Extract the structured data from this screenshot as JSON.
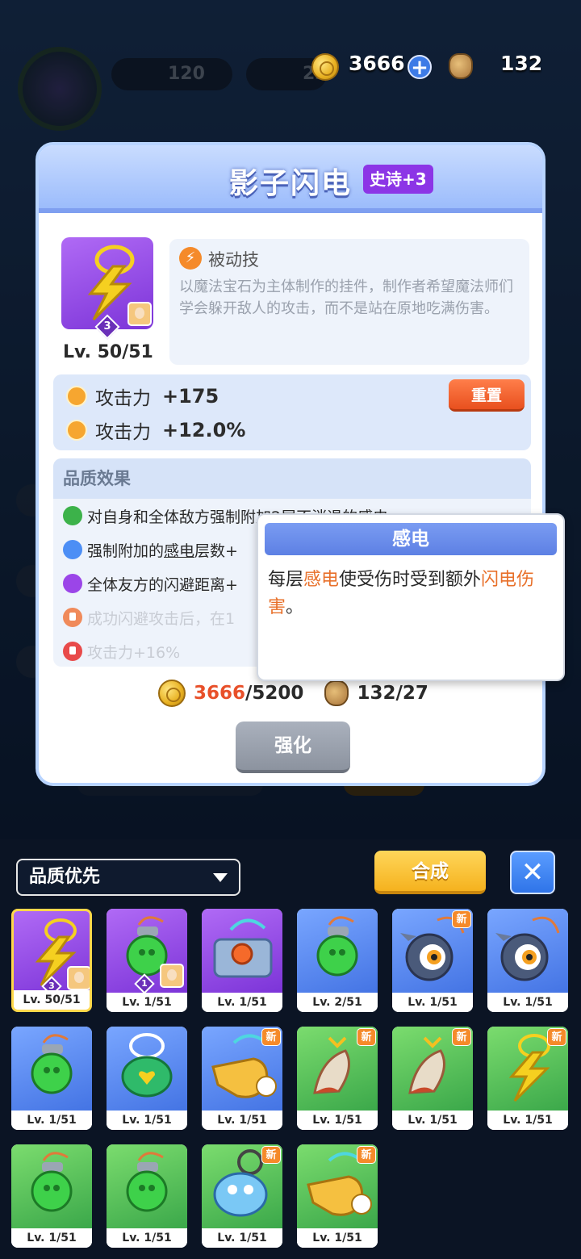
{
  "topbar": {
    "coins": "3666",
    "bags": "132",
    "bg_stat1": "120",
    "bg_stat2": "23"
  },
  "card": {
    "title": "影子闪电",
    "rarity_badge": "史诗+3",
    "level": "Lv. 50/51",
    "star": "3",
    "skill_type": "被动技",
    "description": "以魔法宝石为主体制作的挂件，制作者希望魔法师们学会躲开敌人的攻击，而不是站在原地吃满伤害。",
    "stats": [
      {
        "name": "攻击力",
        "value": "+175"
      },
      {
        "name": "攻击力",
        "value": "+12.0%"
      }
    ],
    "reset_label": "重置",
    "quality_title": "品质效果",
    "quality_effects": [
      {
        "text_a": "对自身和全体敌方强制附加",
        "text_b": "2层不消退的感电",
        "color": "#3cb24a",
        "locked": false
      },
      {
        "text_a": "强制附加的",
        "text_u": "感电",
        "text_b": "层数+",
        "color": "#4c8ef5",
        "locked": false
      },
      {
        "text_a": "全体友方的闪避距离+",
        "color": "#9b45e8",
        "locked": false
      },
      {
        "text_a": "成功闪避攻击后，在1",
        "color": "#f08a5a",
        "locked": true
      },
      {
        "text_a": "攻击力+16%",
        "color": "#e84a4a",
        "locked": true
      }
    ],
    "cost_coins_have": "3666",
    "cost_coins_need": "/5200",
    "cost_bags_have": "132",
    "cost_bags_need": "/27",
    "upgrade_label": "强化"
  },
  "tooltip": {
    "title": "感电",
    "body_a": "每层",
    "body_hl1": "感电",
    "body_b": "使受伤时受到额外",
    "body_hl2": "闪电伤害",
    "body_c": "。"
  },
  "inventory": {
    "sort_label": "品质优先",
    "synth_label": "合成",
    "close_label": "✕",
    "new_label": "新",
    "items": [
      {
        "name": "lightning-pendant",
        "rarity": "purple",
        "level": "Lv. 50/51",
        "star": "3",
        "portrait": true,
        "new": false,
        "selected": true
      },
      {
        "name": "green-orb-pendant",
        "rarity": "purple",
        "level": "Lv. 1/51",
        "star": "1",
        "portrait": true,
        "new": false,
        "selected": false
      },
      {
        "name": "button-box-pendant",
        "rarity": "purple",
        "level": "Lv. 1/51",
        "new": false
      },
      {
        "name": "green-orb-pendant",
        "rarity": "blue",
        "level": "Lv. 2/51",
        "new": false
      },
      {
        "name": "spiked-eye-pendant",
        "rarity": "blue",
        "level": "Lv. 1/51",
        "new": true
      },
      {
        "name": "spiked-eye-pendant",
        "rarity": "blue",
        "level": "Lv. 1/51",
        "new": false
      },
      {
        "name": "green-orb-pendant",
        "rarity": "blue",
        "level": "Lv. 1/51",
        "new": false
      },
      {
        "name": "turtle-heart-pendant",
        "rarity": "blue",
        "level": "Lv. 1/51",
        "new": false
      },
      {
        "name": "whistle-pendant",
        "rarity": "blue",
        "level": "Lv. 1/51",
        "new": true
      },
      {
        "name": "feather-pendant",
        "rarity": "green",
        "level": "Lv. 1/51",
        "new": true
      },
      {
        "name": "feather-pendant",
        "rarity": "green",
        "level": "Lv. 1/51",
        "new": true
      },
      {
        "name": "lightning-pendant",
        "rarity": "green",
        "level": "Lv. 1/51",
        "new": true
      },
      {
        "name": "green-orb-pendant",
        "rarity": "green",
        "level": "Lv. 1/51",
        "new": false
      },
      {
        "name": "green-orb-pendant",
        "rarity": "green",
        "level": "Lv. 1/51",
        "new": false
      },
      {
        "name": "blue-fish-pendant",
        "rarity": "green",
        "level": "Lv. 1/51",
        "new": true
      },
      {
        "name": "whistle-pendant",
        "rarity": "green",
        "level": "Lv. 1/51",
        "new": true
      }
    ]
  }
}
